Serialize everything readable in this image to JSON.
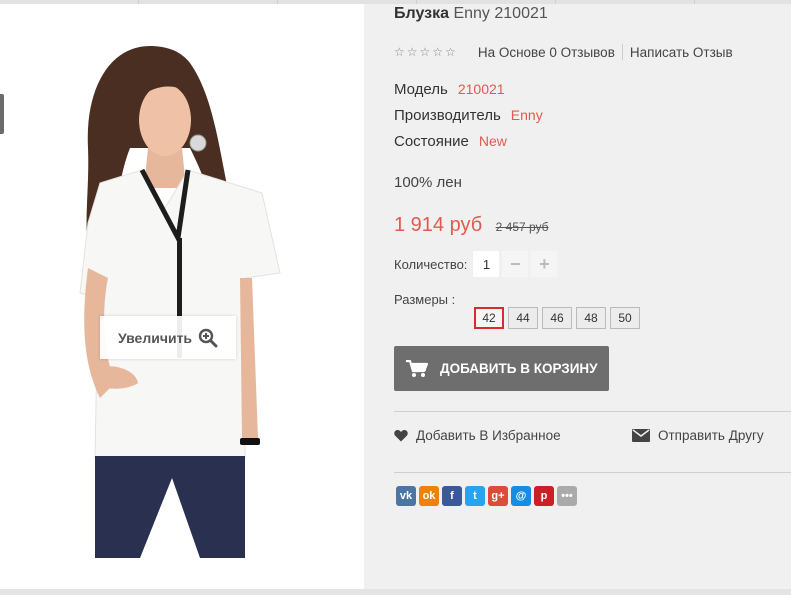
{
  "product": {
    "title_bold": "Блузка",
    "title_rest": "Enny 210021",
    "rating_stars": 0,
    "reviews_link": "На Основе 0 Отзывов",
    "write_review": "Написать Отзыв",
    "model_label": "Модель",
    "model_value": "210021",
    "brand_label": "Производитель",
    "brand_value": "Enny",
    "condition_label": "Состояние",
    "condition_value": "New",
    "description": "100% лен",
    "price_now": "1 914 руб",
    "price_old": "2 457 руб",
    "quantity_label": "Количество:",
    "quantity_value": "1",
    "sizes_label": "Размеры :",
    "sizes": [
      "42",
      "44",
      "46",
      "48",
      "50"
    ],
    "selected_size": "42",
    "add_to_cart": "ДОБАВИТЬ В КОРЗИНУ",
    "wishlist": "Добавить В Избранное",
    "send_friend": "Отправить Другу",
    "zoom_label": "Увеличить"
  },
  "social": [
    {
      "icon": "vk-icon",
      "glyph": "vk",
      "color": "#4c75a3"
    },
    {
      "icon": "odnoklassniki-icon",
      "glyph": "ok",
      "color": "#ee8208"
    },
    {
      "icon": "facebook-icon",
      "glyph": "f",
      "color": "#3b5998"
    },
    {
      "icon": "twitter-icon",
      "glyph": "t",
      "color": "#2aa3ef"
    },
    {
      "icon": "google-plus-icon",
      "glyph": "g+",
      "color": "#dd4b39"
    },
    {
      "icon": "mailru-icon",
      "glyph": "@",
      "color": "#168de2"
    },
    {
      "icon": "pinterest-icon",
      "glyph": "p",
      "color": "#cb2027"
    },
    {
      "icon": "more-icon",
      "glyph": "•••",
      "color": "#aaaaaa"
    }
  ],
  "colors": {
    "accent": "#e05a4e",
    "button": "#6e6e6e",
    "selected_size_border": "#d62e2e"
  }
}
